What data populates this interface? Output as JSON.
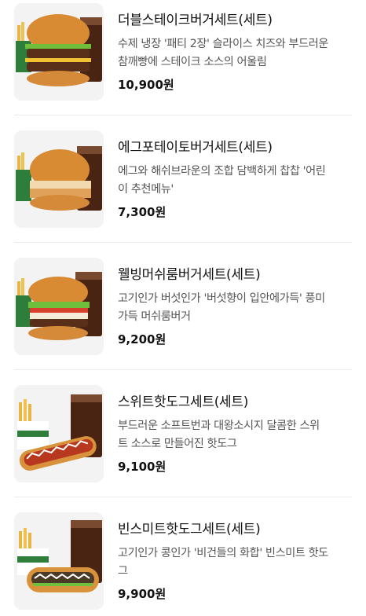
{
  "menu": {
    "items": [
      {
        "name": "더블스테이크버거세트(세트)",
        "desc_line1": "수제 냉장 '패티 2장' 슬라이스 치즈와 부드러운",
        "desc_line2": "참깨빵에 스테이크 소스의 어울림",
        "price": "10,900원",
        "image": "double-steak-burger-set"
      },
      {
        "name": "에그포테이토버거세트(세트)",
        "desc_line1": "에그와 해쉬브라운의 조합 담백하게 찹찹 '어린",
        "desc_line2": "이 추천메뉴'",
        "price": "7,300원",
        "image": "egg-potato-burger-set"
      },
      {
        "name": "웰빙머쉬룸버거세트(세트)",
        "desc_line1": "고기인가 버섯인가 '버섯향이 입안에가득' 풍미",
        "desc_line2": "가득 머쉬룸버거",
        "price": "9,200원",
        "image": "wellbeing-mushroom-burger-set"
      },
      {
        "name": "스위트핫도그세트(세트)",
        "desc_line1": "부드러운 소프트번과 대왕소시지 달콤한 스위",
        "desc_line2": "트 소스로 만들어진 핫도그",
        "price": "9,100원",
        "image": "sweet-hotdog-set"
      },
      {
        "name": "빈스미트핫도그세트(세트)",
        "desc_line1": "고기인가 콩인가 '비건들의 화합' 빈스미트 핫도",
        "desc_line2": "그",
        "price": "9,900원",
        "image": "beans-meat-hotdog-set"
      }
    ]
  }
}
